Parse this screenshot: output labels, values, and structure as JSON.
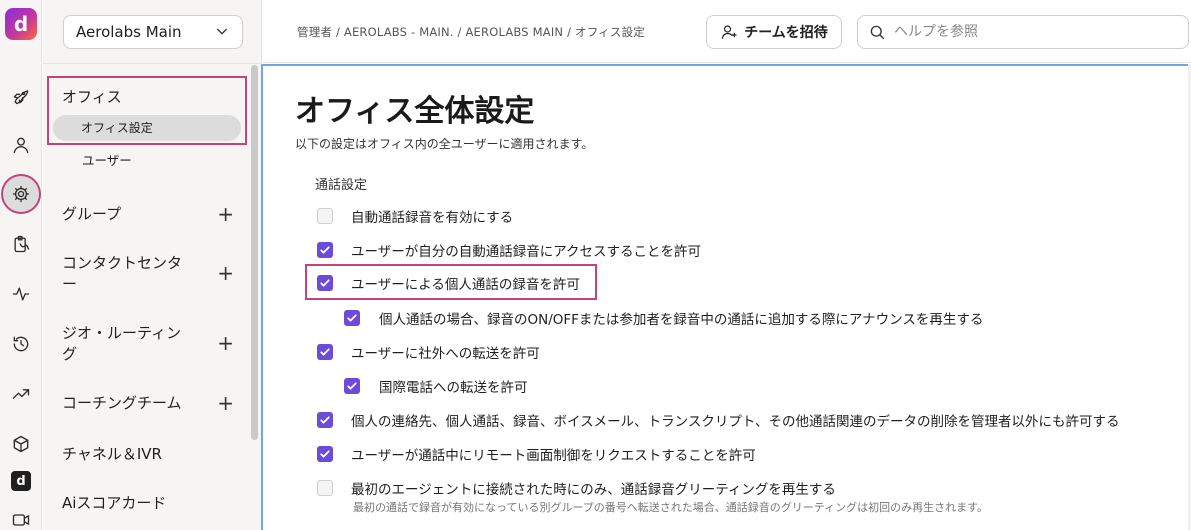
{
  "rail": {
    "logo": "d",
    "icons": [
      "rocket-icon",
      "person-icon",
      "gear-icon",
      "clipboard-icon",
      "activity-icon",
      "history-icon",
      "trending-icon",
      "cube-icon",
      "dialpad-logo-icon",
      "video-icon"
    ]
  },
  "sidebar": {
    "office_name": "Aerolabs Main",
    "office_section": "オフィス",
    "office_settings": "オフィス設定",
    "users": "ユーザー",
    "groups": [
      {
        "label": "グループ"
      },
      {
        "label": "コンタクトセンタ\nー"
      },
      {
        "label": "ジオ・ルーティン\nグ"
      },
      {
        "label": "コーチングチーム"
      }
    ],
    "channels": "チャネル＆IVR",
    "scorecard": "Aiスコアカード"
  },
  "header": {
    "breadcrumb": "管理者 / AEROLABS - MAIN. / AEROLABS MAIN / オフィス設定",
    "invite_label": "チームを招待",
    "search_placeholder": "ヘルプを参照"
  },
  "main": {
    "title": "オフィス全体設定",
    "subtitle": "以下の設定はオフィス内の全ユーザーに適用されます。",
    "section": "通話設定",
    "options": [
      {
        "label": "自動通話録音を有効にする",
        "checked": false
      },
      {
        "label": "ユーザーが自分の自動通話録音にアクセスすることを許可",
        "checked": true
      },
      {
        "label": "ユーザーによる個人通話の録音を許可",
        "checked": true
      },
      {
        "label": "個人通話の場合、録音のON/OFFまたは参加者を録音中の通話に追加する際にアナウンスを再生する",
        "checked": true
      },
      {
        "label": "ユーザーに社外への転送を許可",
        "checked": true
      },
      {
        "label": "国際電話への転送を許可",
        "checked": true
      },
      {
        "label": "個人の連絡先、個人通話、録音、ボイスメール、トランスクリプト、その他通話関連のデータの削除を管理者以外にも許可する",
        "checked": true
      },
      {
        "label": "ユーザーが通話中にリモート画面制御をリクエストすることを許可",
        "checked": true
      },
      {
        "label": "最初のエージェントに接続された時にのみ、通話録音グリーティングを再生する",
        "checked": false
      }
    ],
    "note": "最初の通話で録音が有効になっている別グループの番号へ転送された場合、通話録音のグリーティングは初回のみ再生されます。"
  },
  "colors": {
    "accent": "#6c4bd8",
    "highlight": "#c2447a"
  }
}
